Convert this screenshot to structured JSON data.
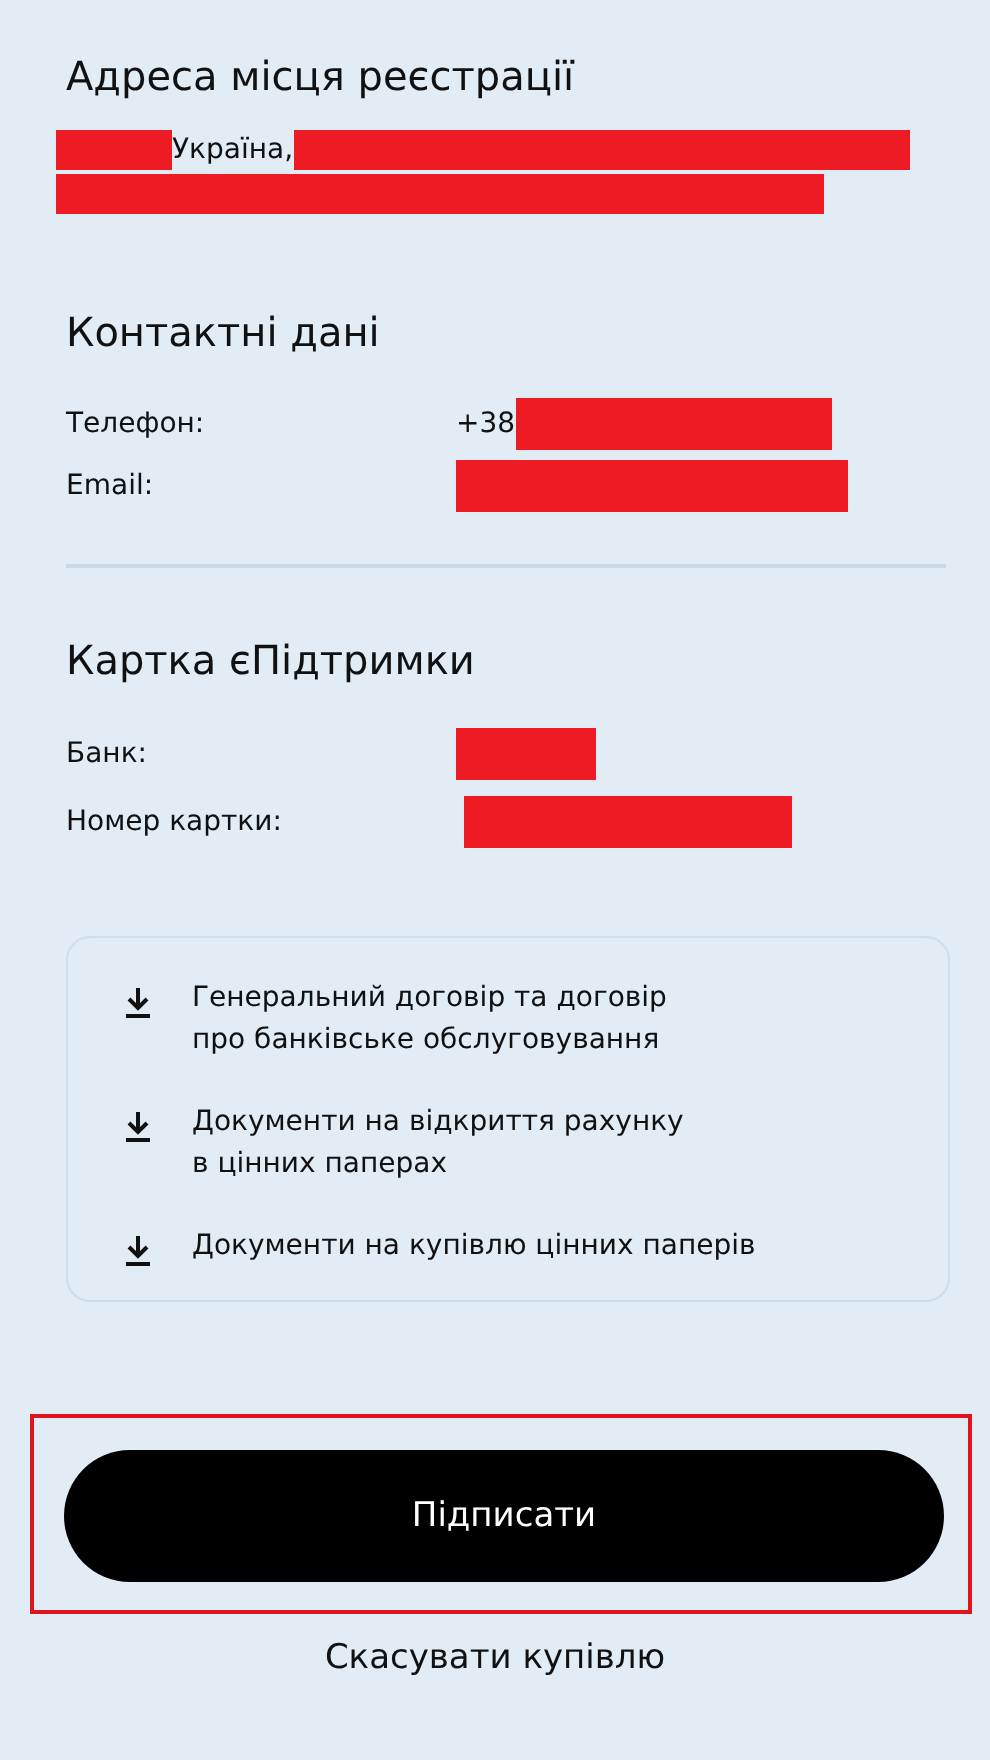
{
  "address": {
    "title": "Адреса місця реєстрації",
    "lines": [
      [
        {
          "kind": "redacted"
        },
        {
          "kind": "text",
          "text": "Україна,"
        },
        {
          "kind": "redacted"
        }
      ],
      [
        {
          "kind": "redacted"
        }
      ]
    ]
  },
  "contacts": {
    "title": "Контактні дані",
    "rows": [
      {
        "label": "Телефон:",
        "value": "+38",
        "redacted": true
      },
      {
        "label": "Email:",
        "redacted": true
      }
    ]
  },
  "card": {
    "title": "Картка єПідтримки",
    "rows": [
      {
        "label": "Банк:",
        "redacted": true
      },
      {
        "label": "Номер картки:",
        "redacted": true
      }
    ]
  },
  "documents": [
    {
      "title": "Генеральний договір та договір\nпро банківське обслуговування"
    },
    {
      "title": "Документи на відкриття рахунку\nв цінних паперах"
    },
    {
      "title": "Документи на купівлю цінних паперів"
    }
  ],
  "sign_button": {
    "label": "Підписати",
    "highlighted": true
  },
  "cancel_link": {
    "label": "Скасувати купівлю"
  }
}
